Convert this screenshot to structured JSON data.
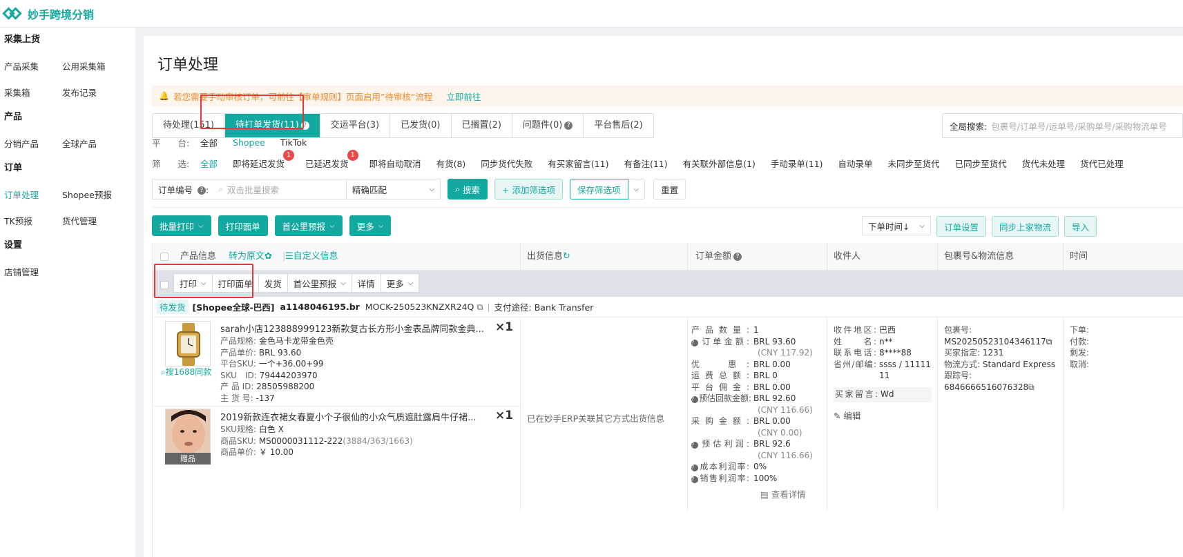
{
  "app": {
    "name": "妙手跨境分销"
  },
  "sidebar": {
    "groups": [
      {
        "title": "采集上货",
        "rows": [
          [
            "产品采集",
            "公用采集箱"
          ],
          [
            "采集箱",
            "发布记录"
          ]
        ]
      },
      {
        "title": "产品",
        "rows": [
          [
            "分销产品",
            "全球产品"
          ]
        ]
      },
      {
        "title": "订单",
        "rows": [
          [
            "订单处理",
            "Shopee预报"
          ],
          [
            "TK预报",
            "货代管理"
          ]
        ]
      },
      {
        "title": "设置",
        "rows": [
          [
            "店铺管理"
          ]
        ]
      }
    ],
    "active": "订单处理"
  },
  "page": {
    "title": "订单处理"
  },
  "notice": {
    "text": "若您需要手动审核订单，可前往【审单规则】页面启用”待审核“流程",
    "link": "立即前往"
  },
  "tabs": [
    {
      "label": "待处理(151)"
    },
    {
      "label": "待打单发货(11)",
      "active": true,
      "help": "?"
    },
    {
      "label": "交运平台(3)"
    },
    {
      "label": "已发货(0)"
    },
    {
      "label": "已搁置(2)"
    },
    {
      "label": "问题件(0)",
      "help": "?"
    },
    {
      "label": "平台售后(2)"
    }
  ],
  "global_search": {
    "label": "全局搜索:",
    "placeholder": "包裹号/订单号/运单号/采购单号/采购物流单号"
  },
  "platform_filter": {
    "label": "平　　台:",
    "options": [
      "全部",
      "Shopee",
      "TikTok"
    ],
    "active": "Shopee"
  },
  "screen_filter": {
    "label": "筛　　选:",
    "options": [
      {
        "text": "全部",
        "active": true
      },
      {
        "text": "即将延迟发货",
        "badge": "1"
      },
      {
        "text": "已延迟发货",
        "badge": "1"
      },
      {
        "text": "即将自动取消"
      },
      {
        "text": "有货(8)"
      },
      {
        "text": "同步货代失败"
      },
      {
        "text": "有买家留言(11)"
      },
      {
        "text": "有备注(11)"
      },
      {
        "text": "有关联外部信息(1)"
      },
      {
        "text": "手动录单(11)"
      },
      {
        "text": "自动录单"
      },
      {
        "text": "未同步至货代"
      },
      {
        "text": "已同步至货代"
      },
      {
        "text": "货代未处理"
      },
      {
        "text": "货代已处理"
      }
    ]
  },
  "search": {
    "field_label": "订单编号",
    "placeholder": "双击批量搜索",
    "match_mode": "精确匹配",
    "search_btn": "搜索",
    "add_filter_btn": "+ 添加筛选项",
    "save_filter_btn": "保存筛选项",
    "reset_btn": "重置"
  },
  "actions": {
    "batch_print": "批量打印",
    "print_label": "打印面单",
    "first_mile": "首公里预报",
    "more": "更多"
  },
  "right_tools": {
    "sort": "下单时间↓",
    "order_settings": "订单设置",
    "sync_logistics": "同步上家物流",
    "import": "导入"
  },
  "table_header": {
    "product": "产品信息",
    "to_original": "转为原文",
    "custom_info": "自定义信息",
    "shipping": "出货信息",
    "amount": "订单金额",
    "receiver": "收件人",
    "package": "包裹号&物流信息",
    "time": "时间"
  },
  "sub_actions": [
    "打印",
    "打印面单",
    "发货",
    "首公里预报",
    "详情",
    "更多"
  ],
  "order": {
    "status": "待发货",
    "shop": "[Shopee全球-巴西]",
    "order_no": "a1148046195.br",
    "package_code": "MOCK-250523KNZXR24Q",
    "payment": "支付途径: Bank Transfer",
    "search1688": "搜1688同款",
    "items": [
      {
        "title": "sarah小店123888999123新款复古长方形小金表品牌同款金典...",
        "qty": "×1",
        "lines": [
          [
            "产品规格:",
            "金色马卡龙带金色壳"
          ],
          [
            "产品单价:",
            "BRL 93.60"
          ],
          [
            "平台SKU:",
            "一个+36.00+99"
          ],
          [
            "SKU　ID:",
            "79444203970"
          ],
          [
            "产 品 ID:",
            "28505988200"
          ],
          [
            "主 货 号:",
            "-137"
          ]
        ]
      },
      {
        "title": "2019新款连衣裙女春夏小个子很仙的小众气质遮肚露肩牛仔裙...",
        "qty": "×1",
        "lines": [
          [
            "SKU规格:",
            "白色 X"
          ],
          [
            "商品SKU:",
            "MS0000031112-222"
          ],
          [
            "商品单价:",
            "￥ 10.00"
          ]
        ],
        "sku_extra": "(3884/363/1663)",
        "gift": "赠品"
      }
    ],
    "shipping_info": "已在妙手ERP关联其它方式出货信息",
    "amounts": [
      {
        "k": "产品数量:",
        "v": "1"
      },
      {
        "k": "订单金额:",
        "v": "BRL 93.60",
        "sub": "(CNY 117.92)",
        "q": true
      },
      {
        "k": "优　惠:",
        "v": "BRL 0.00"
      },
      {
        "k": "运费总额:",
        "v": "BRL 0"
      },
      {
        "k": "平台佣金:",
        "v": "BRL 0.00"
      },
      {
        "k": "预估回款金额:",
        "v": "BRL 92.60",
        "sub": "(CNY 116.66)",
        "q": true
      },
      {
        "k": "采购金额:",
        "v": "BRL 0.00",
        "sub": "(CNY 0.00)"
      },
      {
        "k": "预估利润:",
        "v": "BRL 92.6",
        "sub": "(CNY 116.66)",
        "q": true
      },
      {
        "k": "成本利润率:",
        "v": "0%",
        "q": true
      },
      {
        "k": "销售利润率:",
        "v": "100%",
        "q": true
      }
    ],
    "view_detail": "查看详情",
    "receiver": [
      [
        "收件地区:",
        "巴西"
      ],
      [
        "姓　　名:",
        "n**"
      ],
      [
        "联系电话:",
        "8****88"
      ],
      [
        "省州/邮编:",
        "ssss / 11111"
      ],
      [
        "",
        "11"
      ]
    ],
    "buyer_msg": [
      "买家留言:",
      "Wd"
    ],
    "edit": "编辑",
    "package": {
      "label": "包裹号:",
      "no": "MS20250523104346117",
      "buyer_spec_k": "买家指定:",
      "buyer_spec_v": "1231",
      "method_k": "物流方式:",
      "method_v": "Standard Express",
      "track_k": "跟踪号:",
      "track_no": "6846666516076328"
    },
    "time": [
      "下单:",
      "付款:",
      "剩发:",
      "取消:"
    ]
  }
}
